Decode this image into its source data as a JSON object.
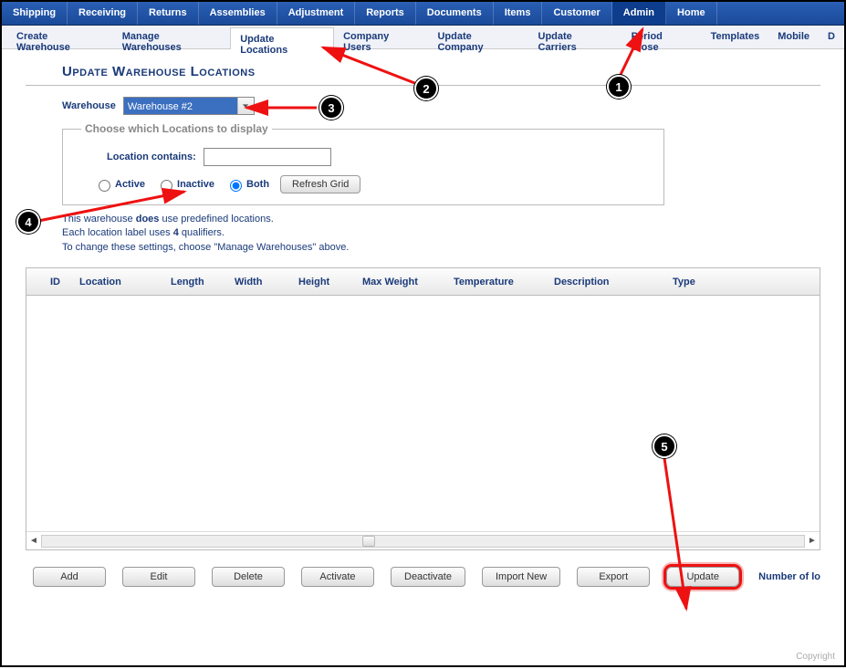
{
  "topnav": [
    "Shipping",
    "Receiving",
    "Returns",
    "Assemblies",
    "Adjustment",
    "Reports",
    "Documents",
    "Items",
    "Customer",
    "Admin",
    "Home"
  ],
  "topnav_active": "Admin",
  "subnav": [
    "Create Warehouse",
    "Manage Warehouses",
    "Update Locations",
    "Company Users",
    "Update Company",
    "Update Carriers",
    "Period Close",
    "Templates",
    "Mobile",
    "D"
  ],
  "subnav_active": "Update Locations",
  "page_title": "Update Warehouse Locations",
  "warehouse_label": "Warehouse",
  "warehouse_selected": "Warehouse #2",
  "filters": {
    "legend": "Choose which Locations to display",
    "contains_label": "Location contains:",
    "contains_value": "",
    "radio_active": "Active",
    "radio_inactive": "Inactive",
    "radio_both": "Both",
    "radio_selected": "Both",
    "refresh_label": "Refresh Grid"
  },
  "info": {
    "line1a": "This warehouse ",
    "line1b": "does",
    "line1c": " use predefined locations.",
    "line2a": "Each location label uses ",
    "line2b": "4",
    "line2c": " qualifiers.",
    "line3": "To change these settings, choose \"Manage Warehouses\" above."
  },
  "grid": {
    "columns": [
      "ID",
      "Location",
      "Length",
      "Width",
      "Height",
      "Max Weight",
      "Temperature",
      "Description",
      "Type"
    ],
    "rows": []
  },
  "actions": {
    "add": "Add",
    "edit": "Edit",
    "delete": "Delete",
    "activate": "Activate",
    "deactivate": "Deactivate",
    "import": "Import New",
    "export": "Export",
    "update": "Update"
  },
  "count_label": "Number of lo",
  "footer": "Copyright",
  "annotations": {
    "b1": "1",
    "b2": "2",
    "b3": "3",
    "b4": "4",
    "b5": "5"
  }
}
